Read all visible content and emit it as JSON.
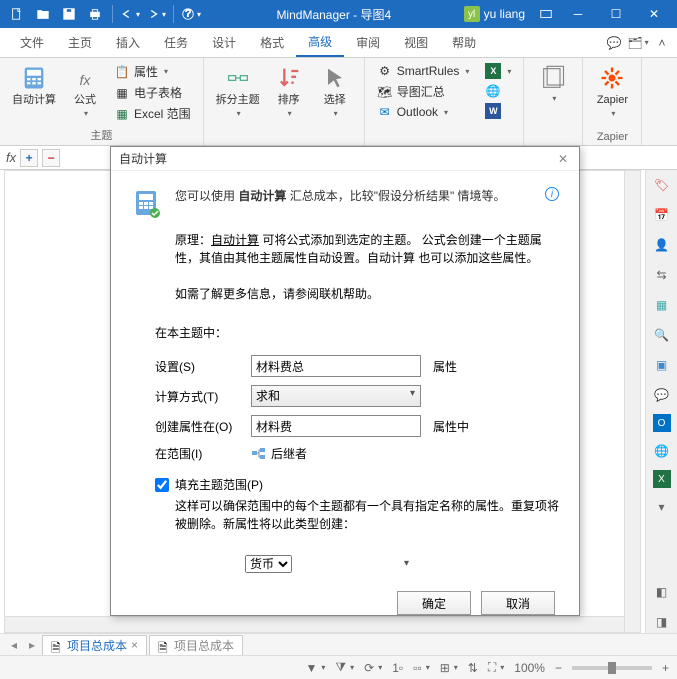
{
  "titlebar": {
    "app": "MindManager",
    "doc": "导图4",
    "user_initials": "yl",
    "user_name": "yu liang"
  },
  "menu": {
    "items": [
      "文件",
      "主页",
      "插入",
      "任务",
      "设计",
      "格式",
      "高级",
      "审阅",
      "视图",
      "帮助"
    ],
    "active": 6
  },
  "ribbon": {
    "auto_calc": "自动计算",
    "formula": "公式",
    "topic_label": "主题",
    "prop": "属性",
    "spreadsheet": "电子表格",
    "excel_range": "Excel 范围",
    "split_topic": "拆分主题",
    "sort": "排序",
    "select": "选择",
    "smartrules": "SmartRules",
    "topic_summary": "导图汇总",
    "outlook": "Outlook",
    "zapier": "Zapier",
    "zapier_group": "Zapier"
  },
  "dialog": {
    "title": "自动计算",
    "intro1a": "您可以使用 ",
    "intro1b": "自动计算",
    "intro1c": " 汇总成本，比较\"假设分析结果\" 情境等。",
    "principle_label": "原理：",
    "principle_b": "自动计算",
    "principle_text": " 可将公式添加到选定的主题。 公式会创建一个主题属性，其值由其他主题属性自动设置。自动计算 也可以添加这些属性。",
    "moreinfo": "如需了解更多信息，请参阅联机帮助。",
    "in_topic": "在本主题中：",
    "lbl_settings": "设置(S)",
    "val_settings": "材料费总",
    "suf_settings": "属性",
    "lbl_method": "计算方式(T)",
    "val_method": "求和",
    "lbl_create_in": "创建属性在(O)",
    "val_create_in": "材料费",
    "suf_create_in": "属性中",
    "lbl_scope": "在范围(I)",
    "val_scope": "后继者",
    "chk_label": "填充主题范围(P)",
    "chk_desc": "这样可以确保范围中的每个主题都有一个具有指定名称的属性。重复项将被删除。新属性将以此类型创建：",
    "type_val": "货币",
    "ok": "确定",
    "cancel": "取消"
  },
  "tabs": {
    "t1": "项目总成本",
    "t2": "项目总成本"
  },
  "status": {
    "zoom": "100%"
  }
}
